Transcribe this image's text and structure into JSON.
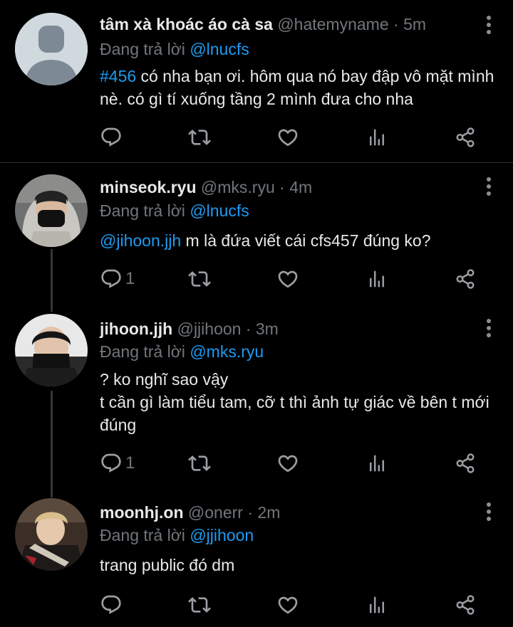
{
  "tweets": [
    {
      "name": "tâm xà khoác áo cà sa",
      "handle": "@hatemyname",
      "dot": "·",
      "time": "5m",
      "replying_prefix": "Đang trả lời ",
      "replying_to": "@lnucfs",
      "body_link": "#456",
      "body_text": " có nha bạn ơi. hôm qua nó bay đập vô mặt mình nè. có gì tí xuống tầng 2 mình đưa cho nha",
      "reply_count": "",
      "avatar": "default-avatar"
    },
    {
      "name": "minseok.ryu",
      "handle": "@mks.ryu",
      "dot": "·",
      "time": "4m",
      "replying_prefix": "Đang trả lời ",
      "replying_to": "@lnucfs",
      "body_link": "@jihoon.jjh",
      "body_text": " m là đứa viết cái cfs457 đúng ko?",
      "reply_count": "1",
      "avatar": "user-photo"
    },
    {
      "name": "jihoon.jjh",
      "handle": "@jjihoon",
      "dot": "·",
      "time": "3m",
      "replying_prefix": "Đang trả lời ",
      "replying_to": "@mks.ryu",
      "body_line1": "? ko nghĩ sao vậy",
      "body_line2": "t cần gì làm tiểu tam, cỡ t thì ảnh tự giác về bên t mới đúng",
      "reply_count": "1",
      "avatar": "user-photo"
    },
    {
      "name": "moonhj.on",
      "handle": "@onerr",
      "dot": "·",
      "time": "2m",
      "replying_prefix": "Đang trả lời ",
      "replying_to": "@jjihoon",
      "body_text": "trang public đó dm",
      "reply_count": "",
      "avatar": "user-photo"
    }
  ],
  "colors": {
    "background": "#000000",
    "link": "#1d9bf0",
    "muted": "#71767b",
    "text": "#e7e9ea"
  },
  "icons": [
    "more-vertical-icon",
    "reply-icon",
    "retweet-icon",
    "like-icon",
    "analytics-icon",
    "share-icon"
  ]
}
